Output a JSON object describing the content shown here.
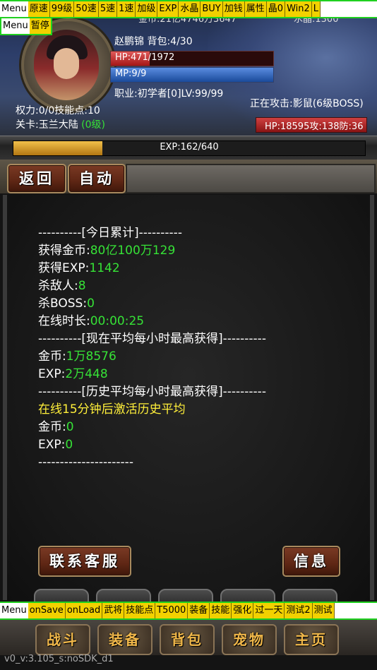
{
  "debug_top": {
    "menu": "Menu",
    "buttons": [
      "原速",
      "99级",
      "50速",
      "5速",
      "1速",
      "加级",
      "EXP",
      "水晶",
      "BUY",
      "加钱",
      "属性",
      "晶0",
      "Win2",
      "L"
    ]
  },
  "debug_top2": {
    "menu": "Menu",
    "pause": "暂停"
  },
  "status": {
    "gold_line": "金币:21亿4746万3647",
    "crystal_line": "水晶:1300",
    "name_bag": "赵鹏锦 背包:4/30",
    "hp": "HP:471/1972",
    "hp_fraction": 0.239,
    "mp": "MP:9/9",
    "mp_fraction": 1.0,
    "job_level": "职业:初学者[0]LV:99/99",
    "power_skill": "权力:0/0技能点:10",
    "stage_label": "关卡:玉兰大陆",
    "stage_level": "(0级)",
    "attacking": "正在攻击:影鼠(6级BOSS)",
    "enemy_stats": "HP:18595攻:138防:36"
  },
  "exp": {
    "label": "EXP:162/640",
    "fraction": 0.253
  },
  "nav": {
    "back": "返回",
    "auto": "自动"
  },
  "log": {
    "today_header": "----------[今日累计]----------",
    "gold_label": "获得金币:",
    "gold_value": "80亿100万129",
    "exp_label": "获得EXP:",
    "exp_value": "1142",
    "kills_label": "杀敌人:",
    "kills_value": "8",
    "boss_label": "杀BOSS:",
    "boss_value": "0",
    "online_label": "在线时长:",
    "online_value": "00:00:25",
    "avg_header": "----------[现在平均每小时最高获得]----------",
    "avg_gold_label": "金币:",
    "avg_gold_value": "1万8576",
    "avg_exp_label": "EXP:",
    "avg_exp_value": "2万448",
    "hist_header": "----------[历史平均每小时最高获得]----------",
    "hist_note": "在线15分钟后激活历史平均",
    "hist_gold_label": "金币:",
    "hist_gold_value": "0",
    "hist_exp_label": "EXP:",
    "hist_exp_value": "0",
    "footer": "----------------------"
  },
  "actions": {
    "contact": "联系客服",
    "info": "信息"
  },
  "debug_bottom": {
    "menu": "Menu",
    "buttons": [
      "onSave",
      "onLoad",
      "武将",
      "技能点",
      "T5000",
      "装备",
      "技能",
      "强化",
      "过一天",
      "测试2",
      "测试"
    ]
  },
  "bottom_nav": [
    "战斗",
    "装备",
    "背包",
    "宠物",
    "主页"
  ],
  "version": "v0_v:3.105_s:noSDK_d1"
}
